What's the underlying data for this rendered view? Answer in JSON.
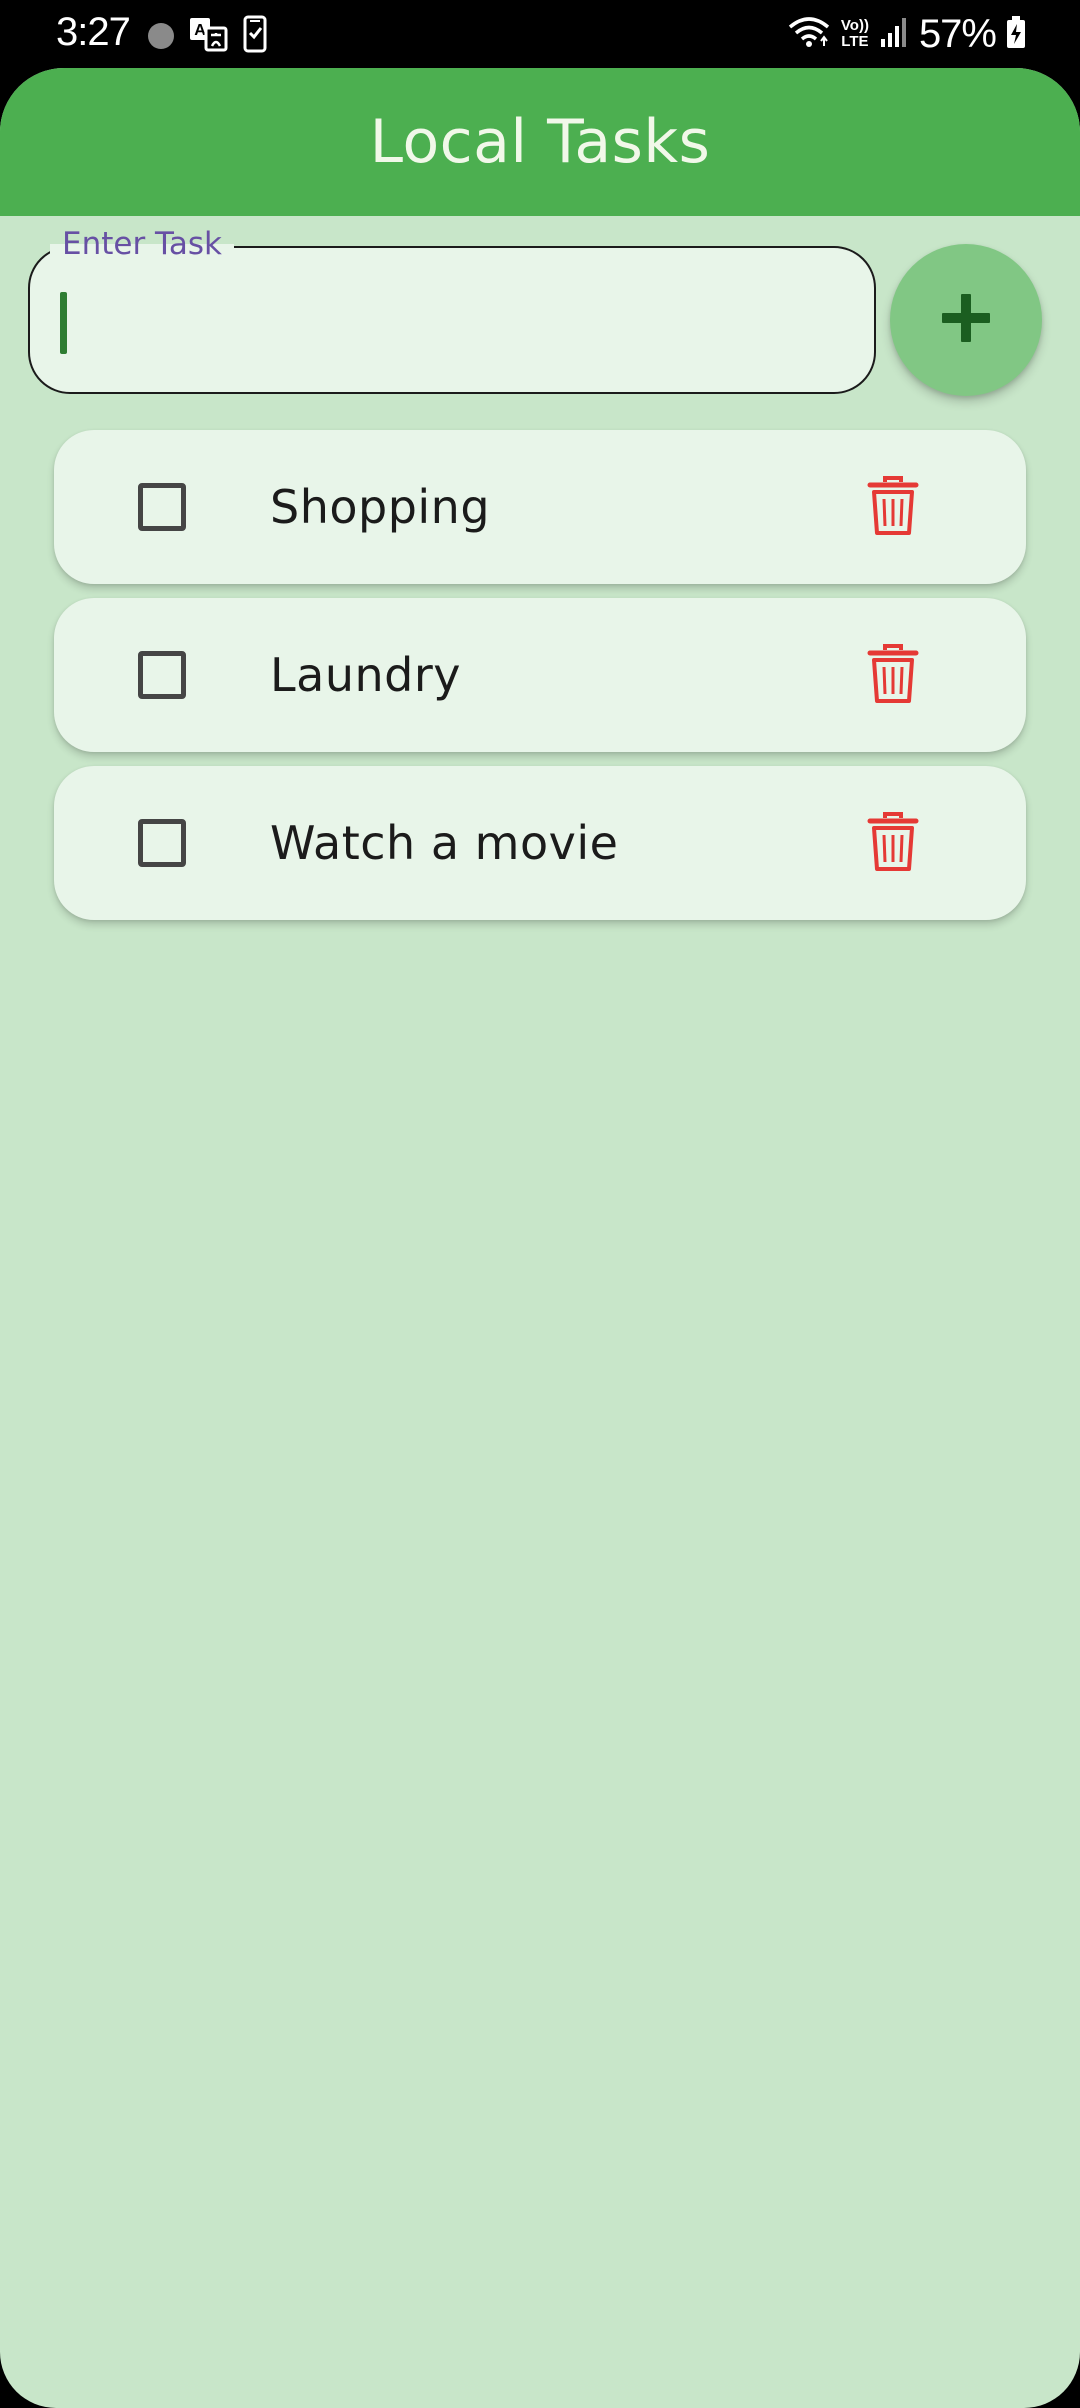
{
  "status_bar": {
    "time": "3:27",
    "battery": "57%",
    "volte_top": "Vo))",
    "volte_bottom": "LTE",
    "icons": [
      "notification-dot-icon",
      "translate-icon",
      "phone-check-icon",
      "wifi-icon",
      "volte-icon",
      "signal-icon",
      "battery-charging-icon"
    ]
  },
  "app_bar": {
    "title": "Local Tasks",
    "color": "#4caf50"
  },
  "task_input": {
    "label": "Enter Task",
    "value": "",
    "label_color": "#6750a4"
  },
  "add_button": {
    "icon": "plus-icon",
    "color": "#81c784"
  },
  "tasks": [
    {
      "label": "Shopping",
      "checked": false
    },
    {
      "label": "Laundry",
      "checked": false
    },
    {
      "label": "Watch a movie",
      "checked": false
    }
  ],
  "delete_icon": {
    "icon": "trash-icon",
    "color": "#e53935"
  },
  "background_color": "#c8e6c9"
}
